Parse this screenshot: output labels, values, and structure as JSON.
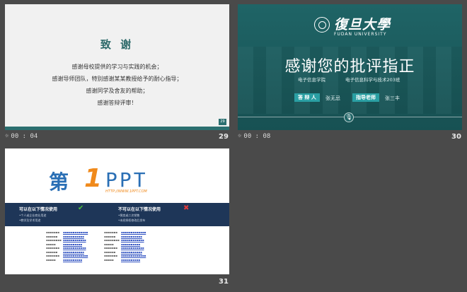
{
  "slides": [
    {
      "number": "29",
      "time": "00 : 04",
      "heading": "致 谢",
      "lines": [
        "感谢母校提供的学习与实践的机会；",
        "感谢导师团队，特别感谢某某教授给予的耐心指导；",
        "感谢同学及舍友的帮助；",
        "感谢答辩评审！"
      ],
      "page_badge": "29"
    },
    {
      "number": "30",
      "time": "00 : 08",
      "university_cn": "復旦大學",
      "university_en": "FUDAN UNIVERSITY",
      "title": "感谢您的批评指正",
      "school": "电子信息学院",
      "class": "电子信息科学与技术203班",
      "defender_label": "答 辩 人",
      "defender_name": "张无忌",
      "advisor_label": "指导老师",
      "advisor_name": "张三丰"
    },
    {
      "number": "31",
      "logo_left": "第",
      "logo_one": "1",
      "logo_ppt": "PPT",
      "logo_url": "HTTP://WWW.1PPT.COM",
      "can_title": "可以在以下情况使用",
      "cannot_title": "不可以在以下情况使用",
      "can_items": [
        "•个人或企业商业用途",
        "•教学及学术用途"
      ],
      "cannot_items": [
        "•倒卖或二次销售",
        "•未经授权修改后发布"
      ]
    }
  ],
  "icons": {
    "time": "clock-icon",
    "mic": "microphone-icon",
    "check": "check-icon",
    "cross": "cross-icon"
  },
  "colors": {
    "background": "#4a4a4a",
    "teal": "#2b6f70",
    "blue": "#2a6fb5",
    "orange": "#f08a1c",
    "navy": "#1e3658"
  }
}
